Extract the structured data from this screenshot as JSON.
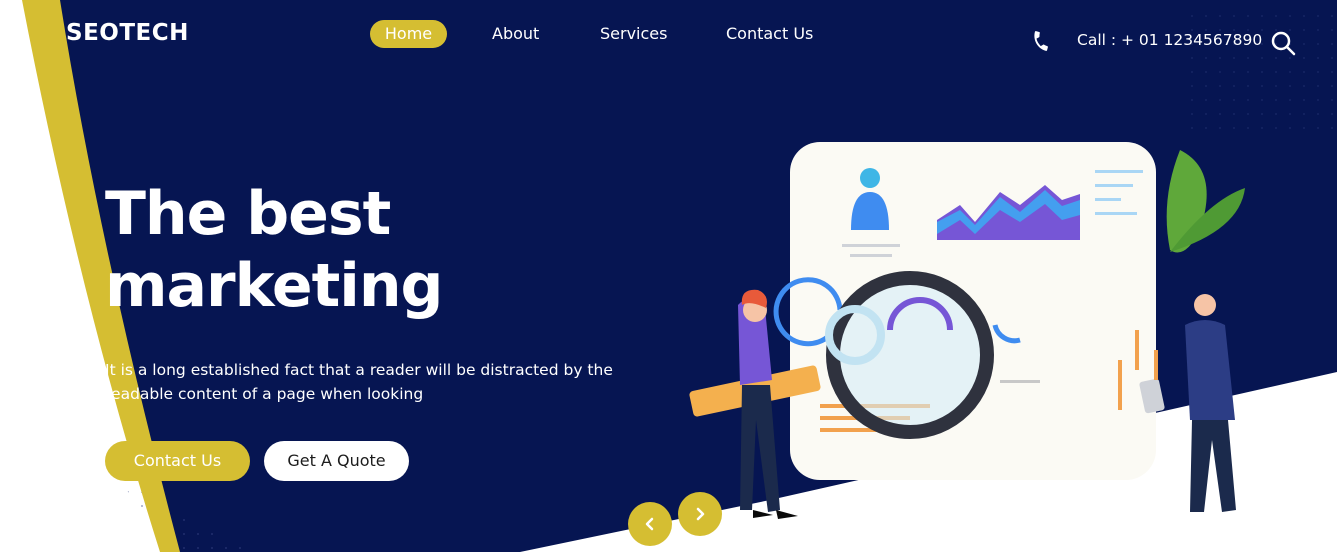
{
  "brand": {
    "name": "SEOTECH"
  },
  "nav": {
    "items": [
      {
        "label": "Home",
        "active": true
      },
      {
        "label": "About",
        "active": false
      },
      {
        "label": "Services",
        "active": false
      },
      {
        "label": "Contact Us",
        "active": false
      }
    ]
  },
  "contact": {
    "call_text": "Call : + 01 1234567890",
    "icon": "phone-icon"
  },
  "search": {
    "icon": "search-icon"
  },
  "hero": {
    "title_line1": "The best",
    "title_line2": "marketing",
    "text": "It is a long established fact that a reader will be distracted by the readable content of a page when looking",
    "primary_button": "Contact Us",
    "secondary_button": "Get A Quote"
  },
  "slider": {
    "prev_icon": "chevron-left-icon",
    "next_icon": "chevron-right-icon"
  },
  "colors": {
    "navy": "#061552",
    "accent": "#d5be32",
    "white": "#ffffff"
  }
}
